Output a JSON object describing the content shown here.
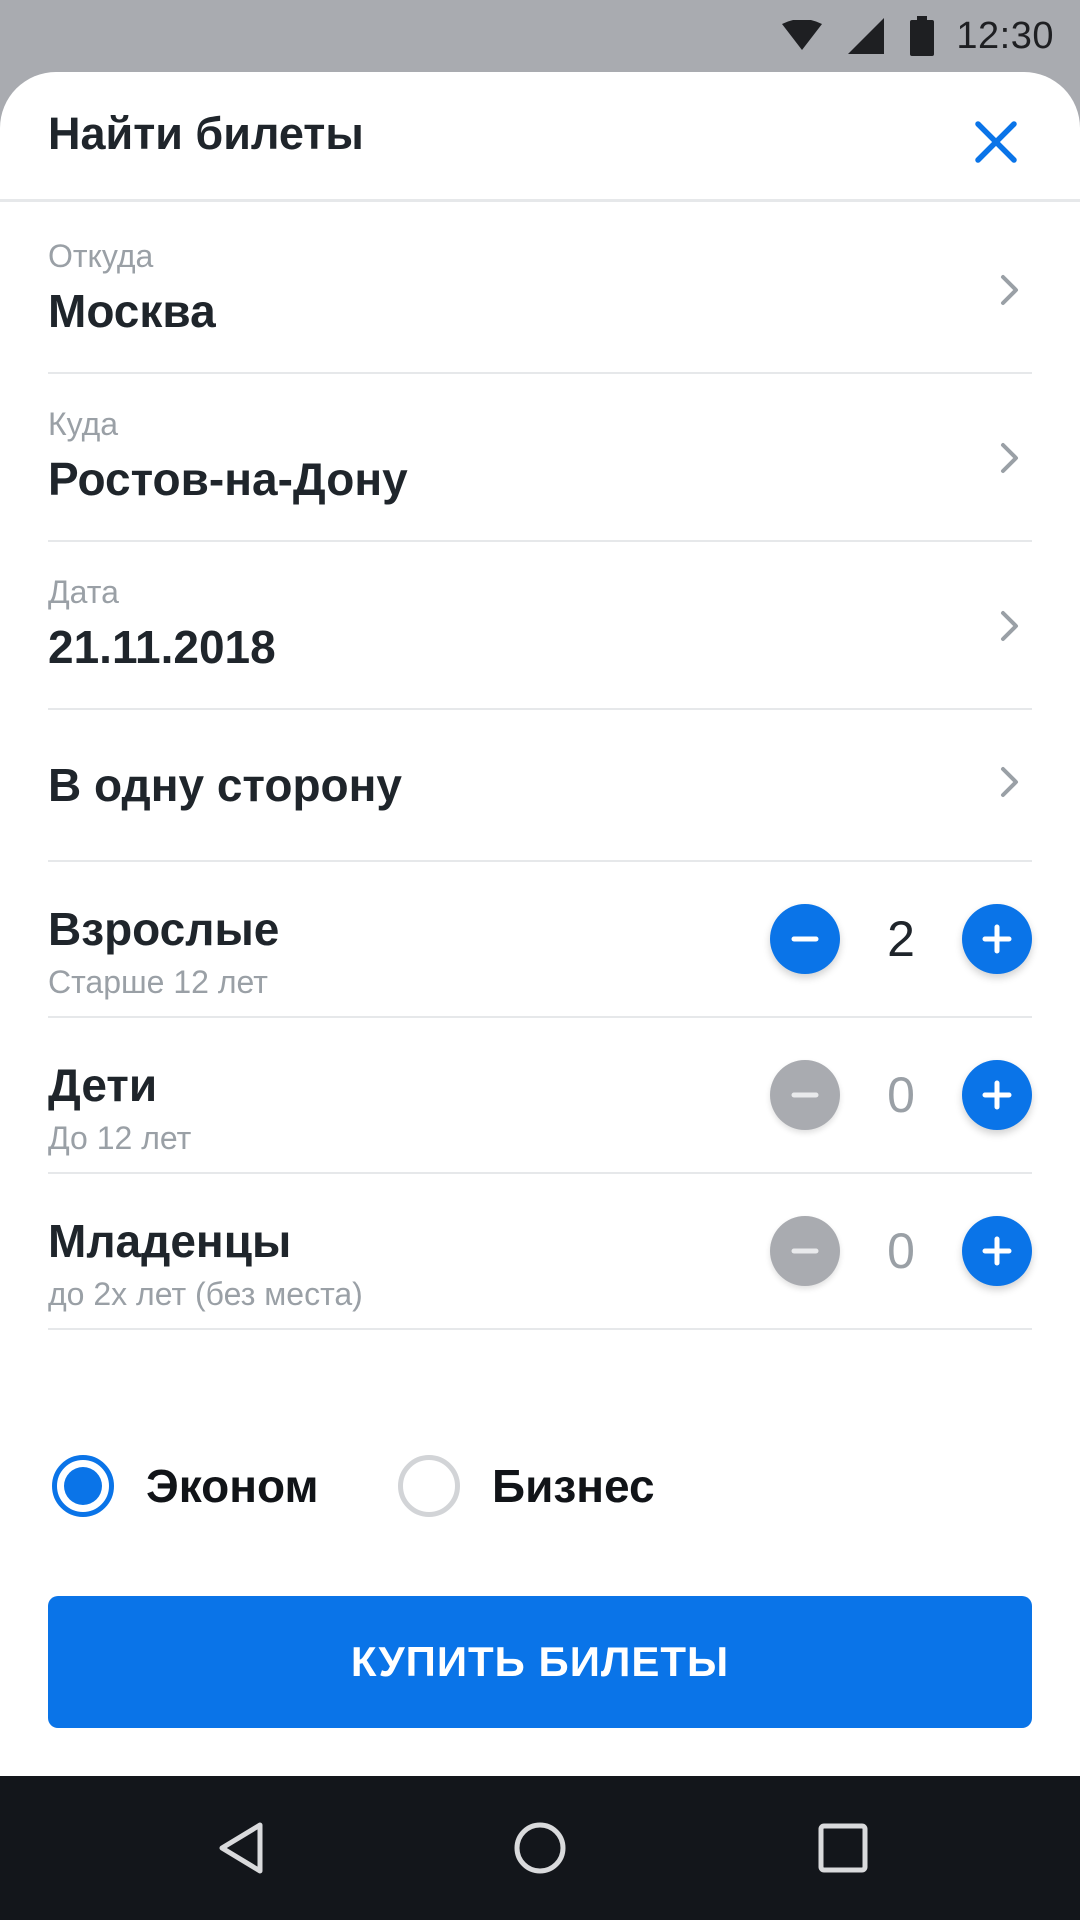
{
  "status_bar": {
    "time": "12:30",
    "icons": [
      "wifi-icon",
      "cell-signal-icon",
      "battery-icon"
    ]
  },
  "header": {
    "title": "Найти билеты",
    "close_icon": "close-icon"
  },
  "route": {
    "from": {
      "label": "Откуда",
      "value": "Москва"
    },
    "to": {
      "label": "Куда",
      "value": "Ростов-на-Дону"
    },
    "date": {
      "label": "Дата",
      "value": "21.11.2018"
    },
    "trip_type": "В одну сторону"
  },
  "passengers": {
    "adults": {
      "title": "Взрослые",
      "subtitle": "Старше 12 лет",
      "count": "2",
      "minus_enabled": true
    },
    "children": {
      "title": "Дети",
      "subtitle": "До 12 лет",
      "count": "0",
      "minus_enabled": false
    },
    "infants": {
      "title": "Младенцы",
      "subtitle": "до 2х лет (без места)",
      "count": "0",
      "minus_enabled": false
    }
  },
  "travel_class": {
    "options": [
      {
        "label": "Эконом",
        "selected": true
      },
      {
        "label": "Бизнес",
        "selected": false
      }
    ]
  },
  "buy_button": {
    "label": "КУПИТЬ БИЛЕТЫ"
  },
  "colors": {
    "accent": "#0a74e8",
    "text": "#1f252b",
    "muted": "#9aa0a6",
    "divider": "#e6e8ea",
    "disabled": "#a9abb0",
    "nav_background": "#13161b"
  },
  "nav_bar": {
    "buttons": [
      "back-icon",
      "home-icon",
      "recents-icon"
    ]
  }
}
